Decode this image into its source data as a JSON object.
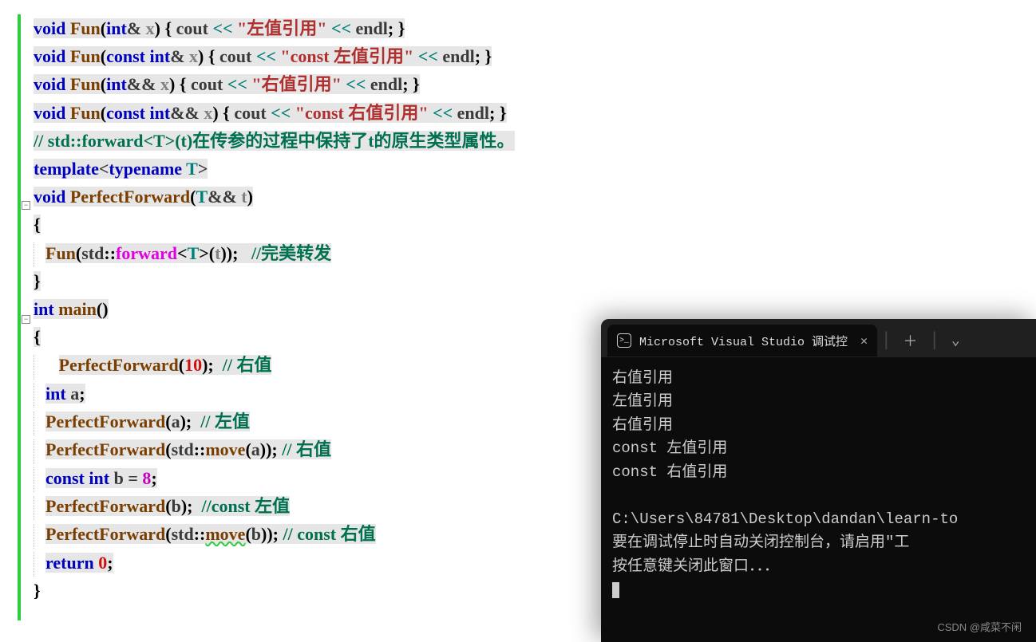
{
  "code": {
    "l1": {
      "void": "void",
      "fn": "Fun",
      "int": "int",
      "amp": "&",
      "x": "x",
      "cout": "cout",
      "op": "<<",
      "str": "\"左值引用\"",
      "endl": "endl"
    },
    "l2": {
      "void": "void",
      "fn": "Fun",
      "const": "const",
      "int": "int",
      "amp": "&",
      "x": "x",
      "cout": "cout",
      "op": "<<",
      "str": "\"const 左值引用\"",
      "endl": "endl"
    },
    "l3": {
      "void": "void",
      "fn": "Fun",
      "int": "int",
      "amp": "&&",
      "x": "x",
      "cout": "cout",
      "op": "<<",
      "str": "\"右值引用\"",
      "endl": "endl"
    },
    "l4": {
      "void": "void",
      "fn": "Fun",
      "const": "const",
      "int": "int",
      "amp": "&&",
      "x": "x",
      "cout": "cout",
      "op": "<<",
      "str": "\"const 右值引用\"",
      "endl": "endl"
    },
    "l5": {
      "comment": "// std::forward<T>(t)在传参的过程中保持了t的原生类型属性。"
    },
    "l6": {
      "template": "template",
      "typename": "typename",
      "T": "T"
    },
    "l7": {
      "void": "void",
      "fn": "PerfectForward",
      "T": "T",
      "amp": "&&",
      "t": "t"
    },
    "l9": {
      "fn": "Fun",
      "std": "std",
      "forward": "forward",
      "T": "T",
      "t": "t",
      "comment": "//完美转发"
    },
    "l11": {
      "int": "int",
      "main": "main"
    },
    "l13": {
      "fn": "PerfectForward",
      "num": "10",
      "comment": "// 右值"
    },
    "l14": {
      "int": "int",
      "a": "a"
    },
    "l15": {
      "fn": "PerfectForward",
      "a": "a",
      "comment": "// 左值"
    },
    "l16": {
      "fn": "PerfectForward",
      "std": "std",
      "move": "move",
      "a": "a",
      "comment": "// 右值"
    },
    "l17": {
      "const": "const",
      "int": "int",
      "b": "b",
      "eq": "=",
      "num": "8"
    },
    "l18": {
      "fn": "PerfectForward",
      "b": "b",
      "comment": "//const 左值"
    },
    "l19": {
      "fn": "PerfectForward",
      "std": "std",
      "move": "move",
      "b": "b",
      "comment": "// const 右值"
    },
    "l20": {
      "return": "return",
      "num": "0"
    }
  },
  "terminal": {
    "tabTitle": "Microsoft Visual Studio 调试控",
    "output": [
      "右值引用",
      "左值引用",
      "右值引用",
      "const 左值引用",
      "const 右值引用",
      "",
      "C:\\Users\\84781\\Desktop\\dandan\\learn-to",
      "要在调试停止时自动关闭控制台，请启用\"工",
      "按任意键关闭此窗口．．．"
    ]
  },
  "watermark": "CSDN @咸菜不闲"
}
